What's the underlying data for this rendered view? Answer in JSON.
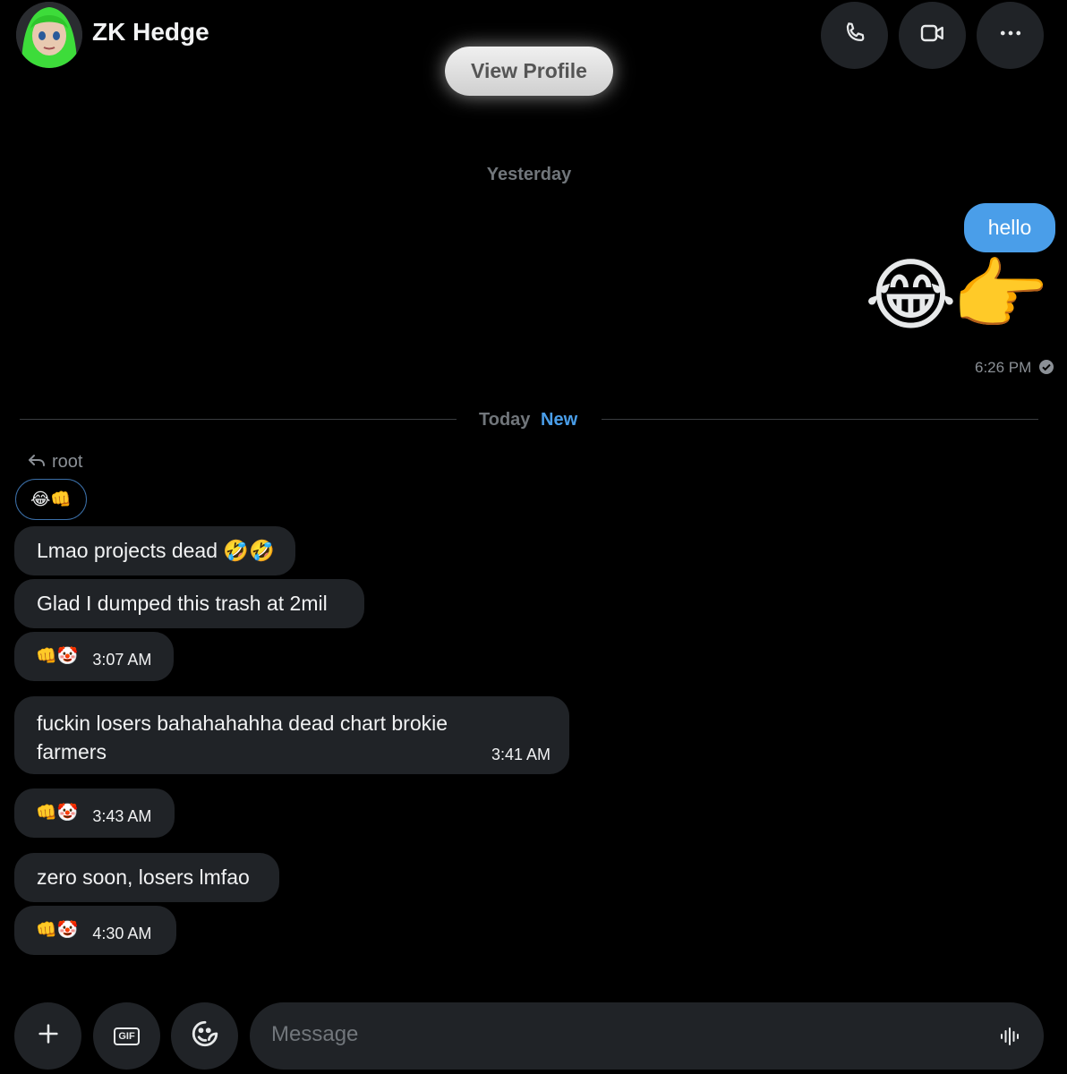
{
  "header": {
    "contact_name": "ZK Hedge",
    "view_profile_label": "View Profile",
    "call_icon": "phone-icon",
    "video_icon": "video-icon",
    "more_icon": "more-icon"
  },
  "conversation": {
    "yesterday_label": "Yesterday",
    "outgoing": {
      "text": "hello",
      "emoji": "😂👉",
      "time": "6:26 PM"
    },
    "today_label": "Today",
    "new_label": "New",
    "reply_to": "root",
    "reply_quote_emoji": "😂👊",
    "messages": [
      {
        "text": "Lmao projects dead 🤣🤣"
      },
      {
        "text": "Glad I dumped this trash at 2mil"
      },
      {
        "reactions": "👊🤡",
        "time": "3:07 AM"
      },
      {
        "text": "fuckin losers bahahahahha dead chart brokie farmers",
        "time": "3:41 AM"
      },
      {
        "reactions": "👊🤡",
        "time": "3:43 AM"
      },
      {
        "text": "zero soon, losers lmfao"
      },
      {
        "reactions": "👊🤡",
        "time": "4:30 AM"
      }
    ]
  },
  "composer": {
    "placeholder": "Message",
    "add_icon": "plus-icon",
    "gif_label": "GIF",
    "emoji_icon": "emoji-icon",
    "voice_icon": "voice-icon"
  },
  "colors": {
    "background": "#000000",
    "bubble_outgoing": "#4a9ee9",
    "bubble_incoming": "#202327",
    "new_label": "#4a9ee9"
  }
}
